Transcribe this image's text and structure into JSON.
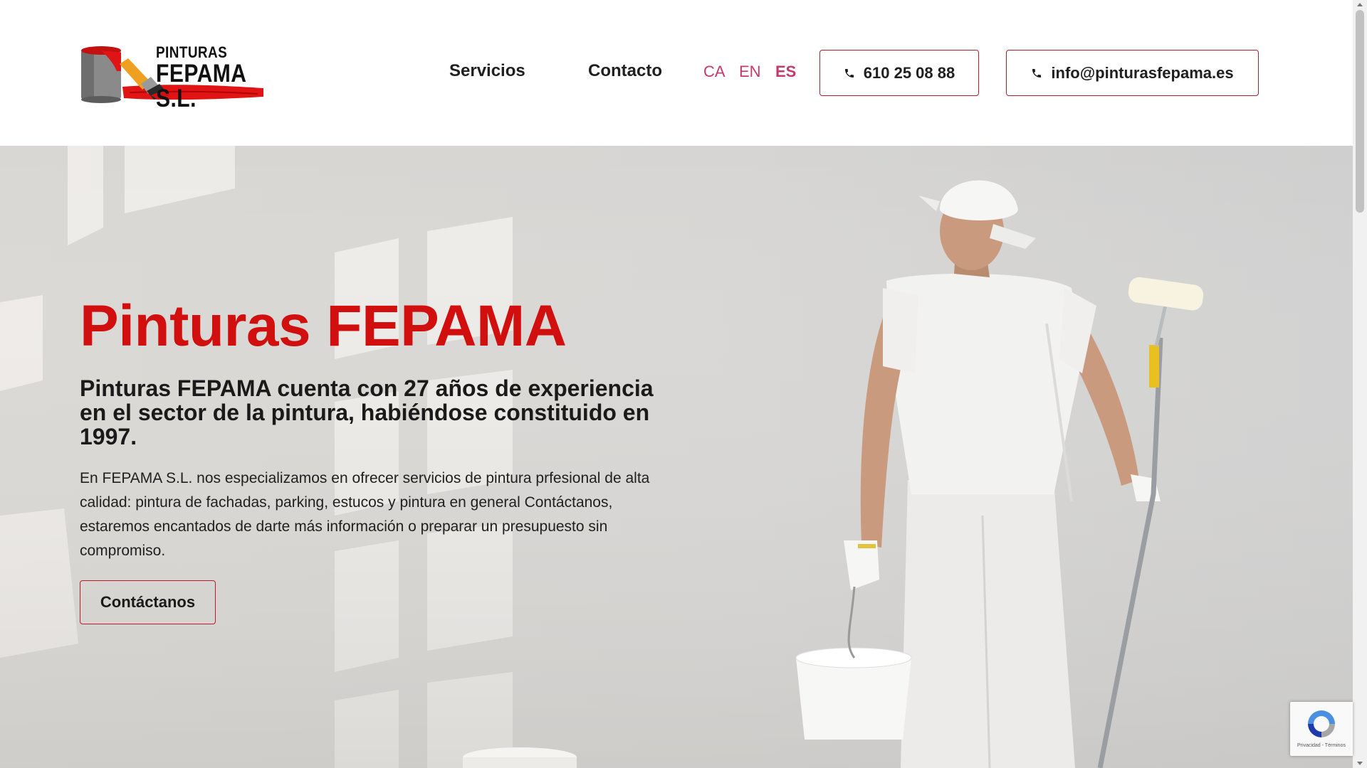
{
  "header": {
    "logo": {
      "line1": "PINTURAS",
      "line2": "FEPAMA S.L."
    },
    "nav": [
      {
        "label": "Servicios"
      },
      {
        "label": "Contacto"
      }
    ],
    "languages": [
      {
        "code": "CA",
        "active": false
      },
      {
        "code": "EN",
        "active": false
      },
      {
        "code": "ES",
        "active": true
      }
    ],
    "phone": {
      "label": "610 25 08 88",
      "icon": "phone-icon"
    },
    "email": {
      "label": "info@pinturasfepama.es",
      "icon": "phone-icon"
    }
  },
  "hero": {
    "title": "Pinturas FEPAMA",
    "subtitle": "Pinturas FEPAMA cuenta con 27 años de experiencia en el sector de la pintura, habiéndose constituido en 1997.",
    "body": "En FEPAMA S.L. nos especializamos en ofrecer servicios de pintura prfesional de alta calidad: pintura de fachadas, parking, estucos y pintura en general Contáctanos, estaremos encantados de darte más información o preparar un presupuesto sin compromiso.",
    "cta_label": "Contáctanos",
    "image": "painter-with-roller-and-bucket"
  },
  "recaptcha": {
    "text": "Privacidad - Términos",
    "icon": "recaptcha-icon"
  },
  "colors": {
    "brand_red": "#d10f0f",
    "button_border": "#b71c2b",
    "language_link": "#c43a6b"
  }
}
